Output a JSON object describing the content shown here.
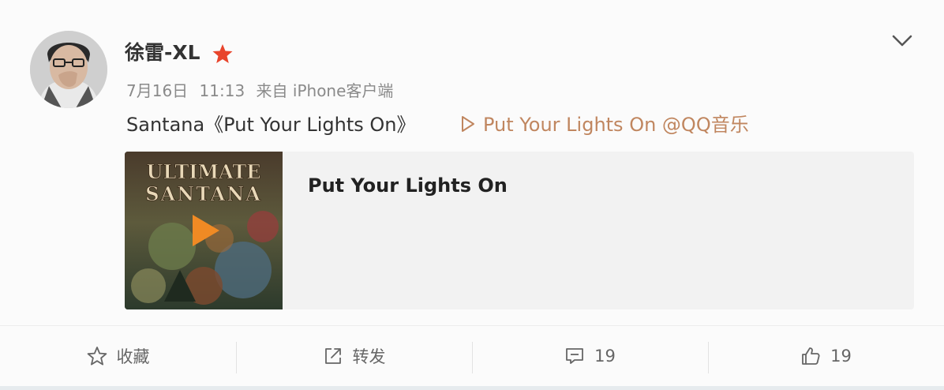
{
  "post": {
    "username": "徐雷-XL",
    "date": "7月16日",
    "time": "11:13",
    "source": "来自 iPhone客户端",
    "text": "Santana《Put Your Lights On》",
    "music_link": {
      "icon": "play-outline-icon",
      "text": "Put Your Lights On @QQ音乐"
    }
  },
  "music_card": {
    "title": "Put Your Lights On",
    "cover_art_text": "ULTIMATE SANTANA",
    "play_icon": "play-triangle-icon"
  },
  "actions": [
    {
      "icon": "star-icon",
      "label": "收藏"
    },
    {
      "icon": "share-icon",
      "label": "转发"
    },
    {
      "icon": "comment-icon",
      "label": "19"
    },
    {
      "icon": "like-icon",
      "label": "19"
    }
  ],
  "colors": {
    "link": "#c0865f",
    "badge": "#e8452c",
    "play_button": "#f08a24",
    "meta_text": "#8a8a8a"
  }
}
